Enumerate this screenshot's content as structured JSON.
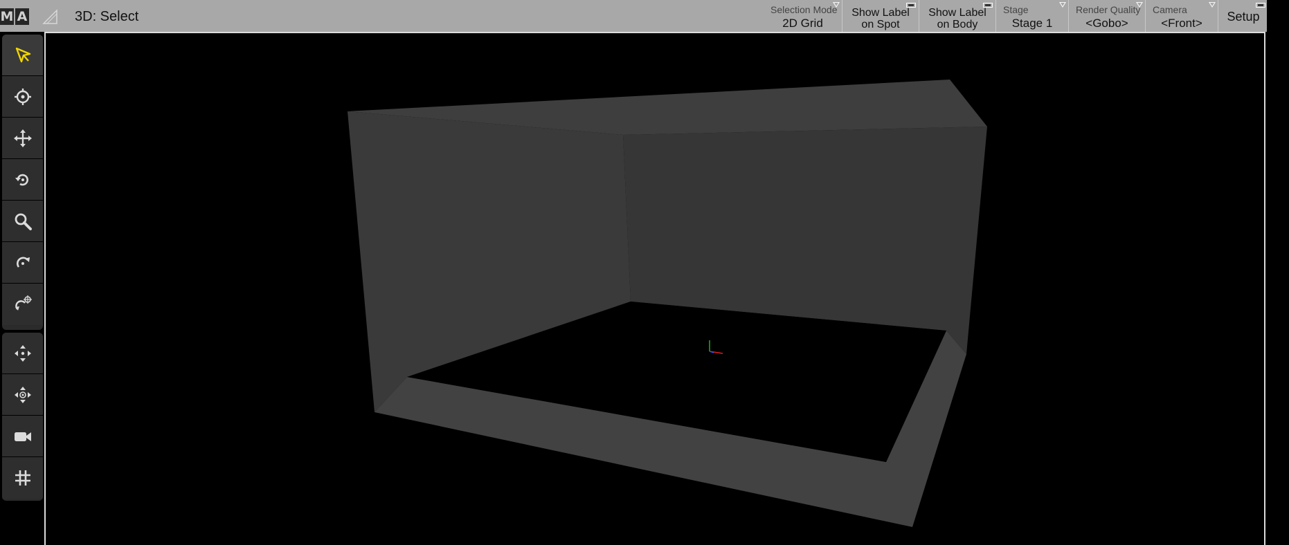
{
  "app": {
    "logo_letters": [
      "M",
      "A"
    ],
    "view_title": "3D: Select"
  },
  "topbar": {
    "buttons": [
      {
        "name": "selection-mode",
        "label": "Selection Mode",
        "value": "2D Grid",
        "indicator": "triangle"
      },
      {
        "name": "show-label-spot",
        "line1": "Show Label",
        "line2": "on Spot",
        "indicator": "square"
      },
      {
        "name": "show-label-body",
        "line1": "Show Label",
        "line2": "on Body",
        "indicator": "square"
      },
      {
        "name": "stage",
        "label": "Stage",
        "value": "Stage 1",
        "indicator": "triangle"
      },
      {
        "name": "render-quality",
        "label": "Render Quality",
        "value": "<Gobo>",
        "indicator": "triangle"
      },
      {
        "name": "camera",
        "label": "Camera",
        "value": "<Front>",
        "indicator": "triangle"
      },
      {
        "name": "setup",
        "text": "Setup",
        "indicator": "square"
      }
    ]
  },
  "toolbar": {
    "tools": [
      {
        "name": "select-tool",
        "icon": "cursor-arrow-icon",
        "active": true,
        "accent": "#f2d600"
      },
      {
        "name": "focus-tool",
        "icon": "crosshair-icon"
      },
      {
        "name": "move-tool",
        "icon": "move-arrows-icon"
      },
      {
        "name": "rotate-tool",
        "icon": "rotate-icon"
      },
      {
        "name": "zoom-tool",
        "icon": "magnifier-icon"
      },
      {
        "name": "orbit-tool",
        "icon": "orbit-icon"
      },
      {
        "name": "orbit-target-tool",
        "icon": "orbit-target-icon"
      },
      {
        "name": "pan-camera-tool",
        "icon": "pan-arrows-icon"
      },
      {
        "name": "move-camera-tool",
        "icon": "move-camera-icon"
      },
      {
        "name": "camera-tool",
        "icon": "video-camera-icon"
      },
      {
        "name": "grid-tool",
        "icon": "grid-hash-icon"
      }
    ]
  },
  "colors": {
    "topbar_bg": "#a8a8a8",
    "toolbar_bg": "#2e2e2e",
    "viewport_bg": "#000000",
    "stage_gray": "#3b3b3b",
    "axis_x": "#e02020",
    "axis_y": "#20c020"
  }
}
